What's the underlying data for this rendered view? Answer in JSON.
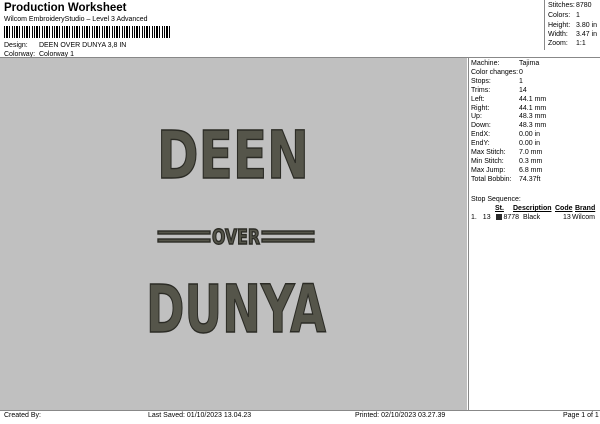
{
  "header": {
    "title": "Production Worksheet",
    "subtitle": "Wilcom EmbroideryStudio – Level 3 Advanced",
    "design_label": "Design:",
    "design_value": "DEEN OVER DUNYA 3,8 IN",
    "colorway_label": "Colorway:",
    "colorway_value": "Colorway 1"
  },
  "stats": [
    {
      "label": "Stitches:",
      "value": "8780"
    },
    {
      "label": "Colors:",
      "value": "1"
    },
    {
      "label": "Height:",
      "value": "3.80 in"
    },
    {
      "label": "Width:",
      "value": "3.47 in"
    },
    {
      "label": "Zoom:",
      "value": "1:1"
    }
  ],
  "design_text": {
    "line1": "DEEN",
    "line2": "OVER",
    "line3": "DUNYA"
  },
  "details": [
    {
      "label": "Machine:",
      "value": "Tajima"
    },
    {
      "label": "Color changes:",
      "value": "0"
    },
    {
      "label": "Stops:",
      "value": "1"
    },
    {
      "label": "Trims:",
      "value": "14"
    },
    {
      "label": "Left:",
      "value": "44.1 mm"
    },
    {
      "label": "Right:",
      "value": "44.1 mm"
    },
    {
      "label": "Up:",
      "value": "48.3 mm"
    },
    {
      "label": "Down:",
      "value": "48.3 mm"
    },
    {
      "label": "EndX:",
      "value": "0.00 in"
    },
    {
      "label": "EndY:",
      "value": "0.00 in"
    },
    {
      "label": "Max Stitch:",
      "value": "7.0 mm"
    },
    {
      "label": "Min Stitch:",
      "value": "0.3 mm"
    },
    {
      "label": "Max Jump:",
      "value": "6.8 mm"
    },
    {
      "label": "Total Bobbin:",
      "value": "74.37ft"
    }
  ],
  "stop_sequence": {
    "title": "Stop Sequence:",
    "columns": [
      "St.",
      "Description",
      "Code",
      "Brand"
    ],
    "rows": [
      {
        "index": "1.",
        "number": "13",
        "stitches": "8778",
        "swatch": "#2b2b2b",
        "description": "Black",
        "code": "13",
        "brand": "Wilcom"
      }
    ]
  },
  "footer": {
    "created_by": "Created By:",
    "last_saved": "Last Saved: 01/10/2023 13.04.23",
    "printed": "Printed: 02/10/2023 03.27.39",
    "page": "Page 1 of 1"
  }
}
